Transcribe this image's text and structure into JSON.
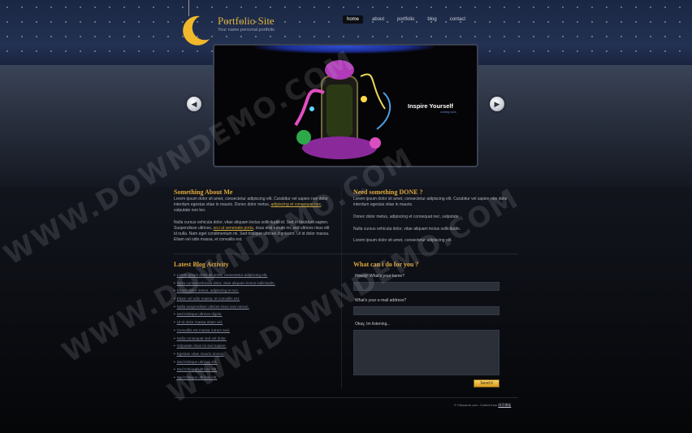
{
  "header": {
    "title": "Portfolio Site",
    "tagline": "Your name personal portfolio"
  },
  "nav": {
    "items": [
      {
        "label": "home",
        "active": true
      },
      {
        "label": "about",
        "active": false
      },
      {
        "label": "portfolio",
        "active": false
      },
      {
        "label": "blog",
        "active": false
      },
      {
        "label": "contact",
        "active": false
      }
    ]
  },
  "slider": {
    "caption": "Inspire Yourself",
    "subcaption": "coming soon",
    "prev_icon": "chevron-left-icon",
    "next_icon": "chevron-right-icon"
  },
  "about": {
    "heading": "Something About Me",
    "para1_pre": "Lorem ipsum dolor sit amet, consectetur adipiscing elit. Curabitur vel sapien non dolor interdum egestas vitae in mauris. Donec dolor metus,",
    "para1_link": "adipiscing et consequat nec",
    "para1_post": ", vulputate non leo.",
    "para2_pre": "Nulla cursus vehicula dolor, vitae aliquam lectus sollicitudin id. Sed in tincidunt sapien. Suspendisse ultrices,",
    "para2_link": "orci ut venenatis porta",
    "para2_post": ", risus erat rutrum mi, sed ultrices risus elit id nulla. Nam eget condimentum mi. Sed tristique ultrices dignissim. Ut id dolor massa. Etiam vel odio massa, et convallis est."
  },
  "done": {
    "heading": "Need something DONE ?",
    "para1": "Lorem ipsum dolor sit amet, consectetur adipiscing elit. Curabitur vel sapien non dolor interdum egestas vitae in mauris.",
    "para2": "Donec dolor metus, adipiscing et consequat nec, vulputate",
    "para3": "Nulla cursus vehicula dolor, vitae aliquam lectus sollicitudin.",
    "para4": "Lorem ipsum dolor sit amet, consectetur adipiscing elit."
  },
  "blog": {
    "heading": "Latest Blog Activity",
    "items": [
      "Lorem ipsum dolor sit amet, consectetur adipiscing elit.",
      "Nulla cursus vehicula dolor, vitae aliquam lectus sollicitudin.",
      "Donec dolor metus, adipiscing et nec.",
      "Etiam vel odio massa, et convallis est.",
      "Nulla suspendisse ultrices risus erat rutrum.",
      "Sed tristique ultrices dignis.",
      "Ut id dolor massa etiam vel.",
      "Convallis est massa rutrum sed.",
      "Nulla consequat sed vel dolor.",
      "Vulputate risus mi sed sapien.",
      "Egestas vitae mauris donec.",
      "Sed tristique ultrices elit.",
      "Sed tristique ultrices elit.",
      "Sed tristique ultrices elit."
    ]
  },
  "contact": {
    "heading": "What can i do for you ?",
    "name_label": "Howdy! What's your name?",
    "email_label": "What's your e-mail address?",
    "message_label": "Okay, Im listening...",
    "send_label": "Send it"
  },
  "footer": {
    "copyright": "© Sitename.com. Collect from",
    "link": "网页模板"
  },
  "watermark": {
    "text": "WWW.DOWNDEMO.COM"
  },
  "colors": {
    "accent": "#e0a93a",
    "background": "#070a10"
  }
}
